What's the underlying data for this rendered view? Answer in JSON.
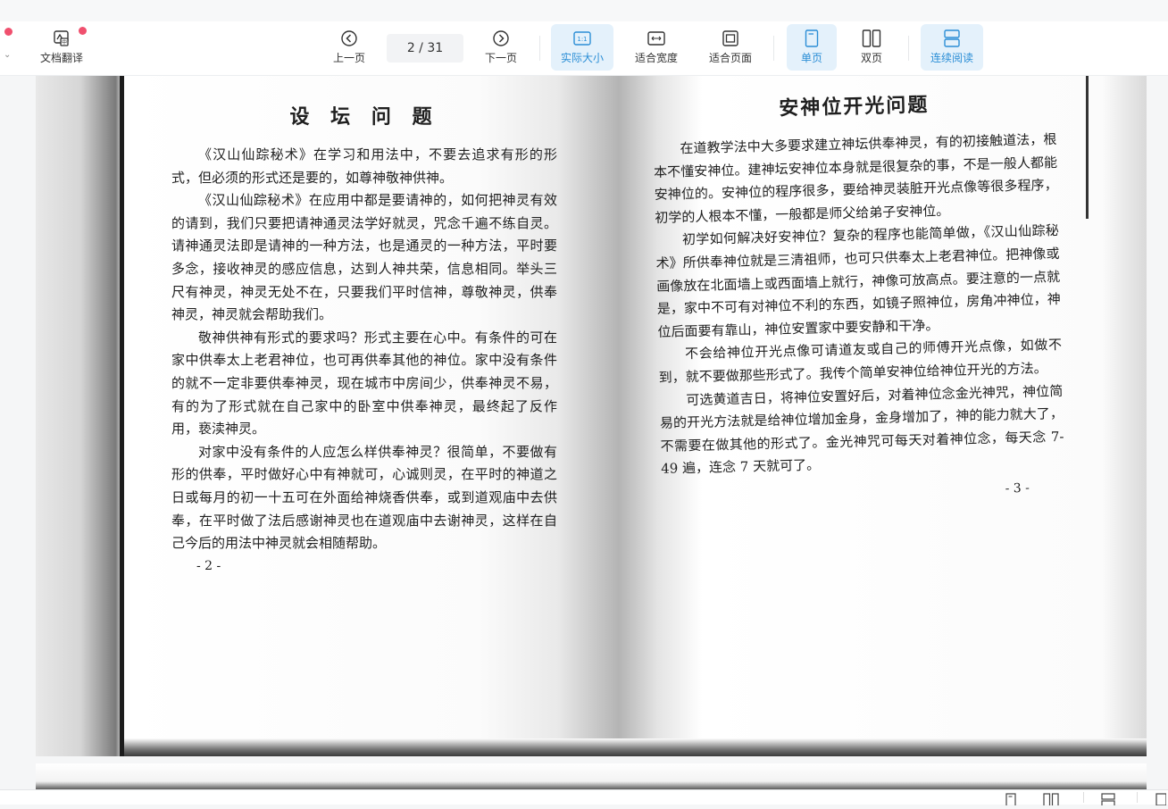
{
  "toolbar": {
    "translate_label": "文档翻译",
    "prev_label": "上一页",
    "page_indicator": "2 / 31",
    "next_label": "下一页",
    "actual_size_label": "实际大小",
    "fit_width_label": "适合宽度",
    "fit_page_label": "适合页面",
    "single_page_label": "单页",
    "double_page_label": "双页",
    "continuous_label": "连续阅读"
  },
  "colors": {
    "accent": "#2b8ed6",
    "active_bg": "#e4f1fb",
    "notify_dot": "#f0506e"
  },
  "document": {
    "left": {
      "title": "设 坛 问 题",
      "paragraphs": [
        "《汉山仙踪秘术》在学习和用法中，不要去追求有形的形式，但必须的形式还是要的，如尊神敬神供神。",
        "《汉山仙踪秘术》在应用中都是要请神的，如何把神灵有效的请到，我们只要把请神通灵法学好就灵，咒念千遍不练自灵。请神通灵法即是请神的一种方法，也是通灵的一种方法，平时要多念，接收神灵的感应信息，达到人神共荣，信息相同。举头三尺有神灵，神灵无处不在，只要我们平时信神，尊敬神灵，供奉神灵，神灵就会帮助我们。",
        "敬神供神有形式的要求吗？形式主要在心中。有条件的可在家中供奉太上老君神位，也可再供奉其他的神位。家中没有条件的就不一定非要供奉神灵，现在城市中房间少，供奉神灵不易，有的为了形式就在自己家中的卧室中供奉神灵，最终起了反作用，亵渎神灵。",
        "对家中没有条件的人应怎么样供奉神灵？很简单，不要做有形的供奉，平时做好心中有神就可，心诚则灵，在平时的神道之日或每月的初一十五可在外面给神烧香供奉，或到道观庙中去供奉，在平时做了法后感谢神灵也在道观庙中去谢神灵，这样在自己今后的用法中神灵就会相随帮助。"
      ],
      "page_number": "- 2 -"
    },
    "right": {
      "title": "安神位开光问题",
      "paragraphs": [
        "在道教学法中大多要求建立神坛供奉神灵，有的初接触道法，根本不懂安神位。建神坛安神位本身就是很复杂的事，不是一般人都能安神位的。安神位的程序很多，要给神灵装脏开光点像等很多程序，初学的人根本不懂，一般都是师父给弟子安神位。",
        "初学如何解决好安神位？复杂的程序也能简单做，《汉山仙踪秘术》所供奉神位就是三清祖师，也可只供奉太上老君神位。把神像或画像放在北面墙上或西面墙上就行，神像可放高点。要注意的一点就是，家中不可有对神位不利的东西，如镜子照神位，房角冲神位，神位后面要有靠山，神位安置家中要安静和干净。",
        "不会给神位开光点像可请道友或自己的师傅开光点像，如做不到，就不要做那些形式了。我传个简单安神位给神位开光的方法。",
        "可选黄道吉日，将神位安置好后，对着神位念金光神咒，神位简易的开光方法就是给神位增加金身，金身增加了，神的能力就大了，不需要在做其他的形式了。金光神咒可每天对着神位念，每天念 7-49 遍，连念 7 天就可了。"
      ],
      "page_number": "- 3 -"
    }
  }
}
